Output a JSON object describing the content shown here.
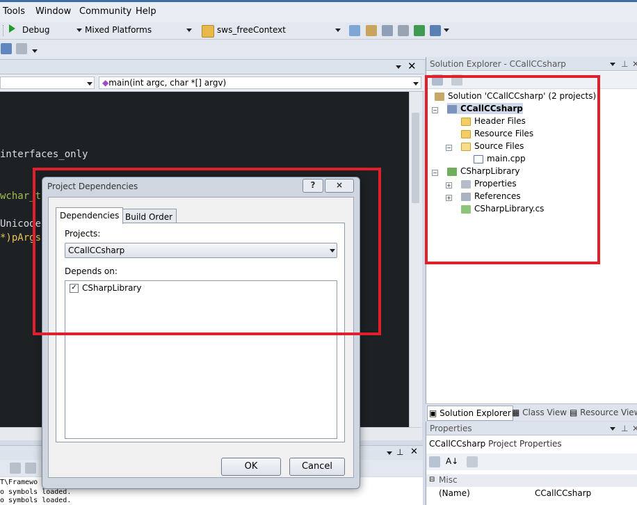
{
  "menu": [
    "Tools",
    "Window",
    "Community",
    "Help"
  ],
  "toolbar": {
    "config": "Debug",
    "platform": "Mixed Platforms",
    "find_combo": "sws_freeContext"
  },
  "editor": {
    "nav_combo": "main(int argc, char *[] argv)",
    "code_lines": [
      {
        "text": "interfaces_only",
        "color": "#d8dde4"
      },
      {
        "text": "wchar_t",
        "color": "#9fc04c"
      },
      {
        "text": "Unicode",
        "color": "#d8dde4"
      },
      {
        "text": "*)pArgs",
        "color": "#e8c35a"
      }
    ]
  },
  "output": {
    "lines": [
      "T\\Framewo",
      "o symbols loaded.",
      "o symbols loaded."
    ]
  },
  "solution_explorer": {
    "title": "Solution Explorer - CCallCCsharp",
    "items": [
      {
        "label": "Solution 'CCallCCsharp' (2 projects)",
        "icon": "solution-icon"
      },
      {
        "label": "CCallCCsharp",
        "icon": "cpp-project-icon",
        "bold": true
      },
      {
        "label": "Header Files",
        "icon": "folder-icon"
      },
      {
        "label": "Resource Files",
        "icon": "folder-icon"
      },
      {
        "label": "Source Files",
        "icon": "folder-open-icon"
      },
      {
        "label": "main.cpp",
        "icon": "cpp-file-icon"
      },
      {
        "label": "CSharpLibrary",
        "icon": "csharp-project-icon"
      },
      {
        "label": "Properties",
        "icon": "properties-icon"
      },
      {
        "label": "References",
        "icon": "references-icon"
      },
      {
        "label": "CSharpLibrary.cs",
        "icon": "csharp-file-icon"
      }
    ],
    "tabs": [
      "Solution Explorer",
      "Class View",
      "Resource View"
    ]
  },
  "properties": {
    "title": "Properties",
    "object": "CCallCCsharp",
    "object_type": "Project Properties",
    "category": "Misc",
    "rows": [
      {
        "name": "(Name)",
        "value": "CCallCCsharp"
      }
    ]
  },
  "dialog": {
    "title": "Project Dependencies",
    "help": "?",
    "close": "×",
    "tabs": [
      "Dependencies",
      "Build Order"
    ],
    "projects_label": "Projects:",
    "project_selected": "CCallCCsharp",
    "depends_label": "Depends on:",
    "dependencies": [
      {
        "label": "CSharpLibrary",
        "checked": true
      }
    ],
    "ok": "OK",
    "cancel": "Cancel"
  },
  "colors": {
    "highlight": "#e0202a",
    "editor_bg": "#1e2124"
  }
}
